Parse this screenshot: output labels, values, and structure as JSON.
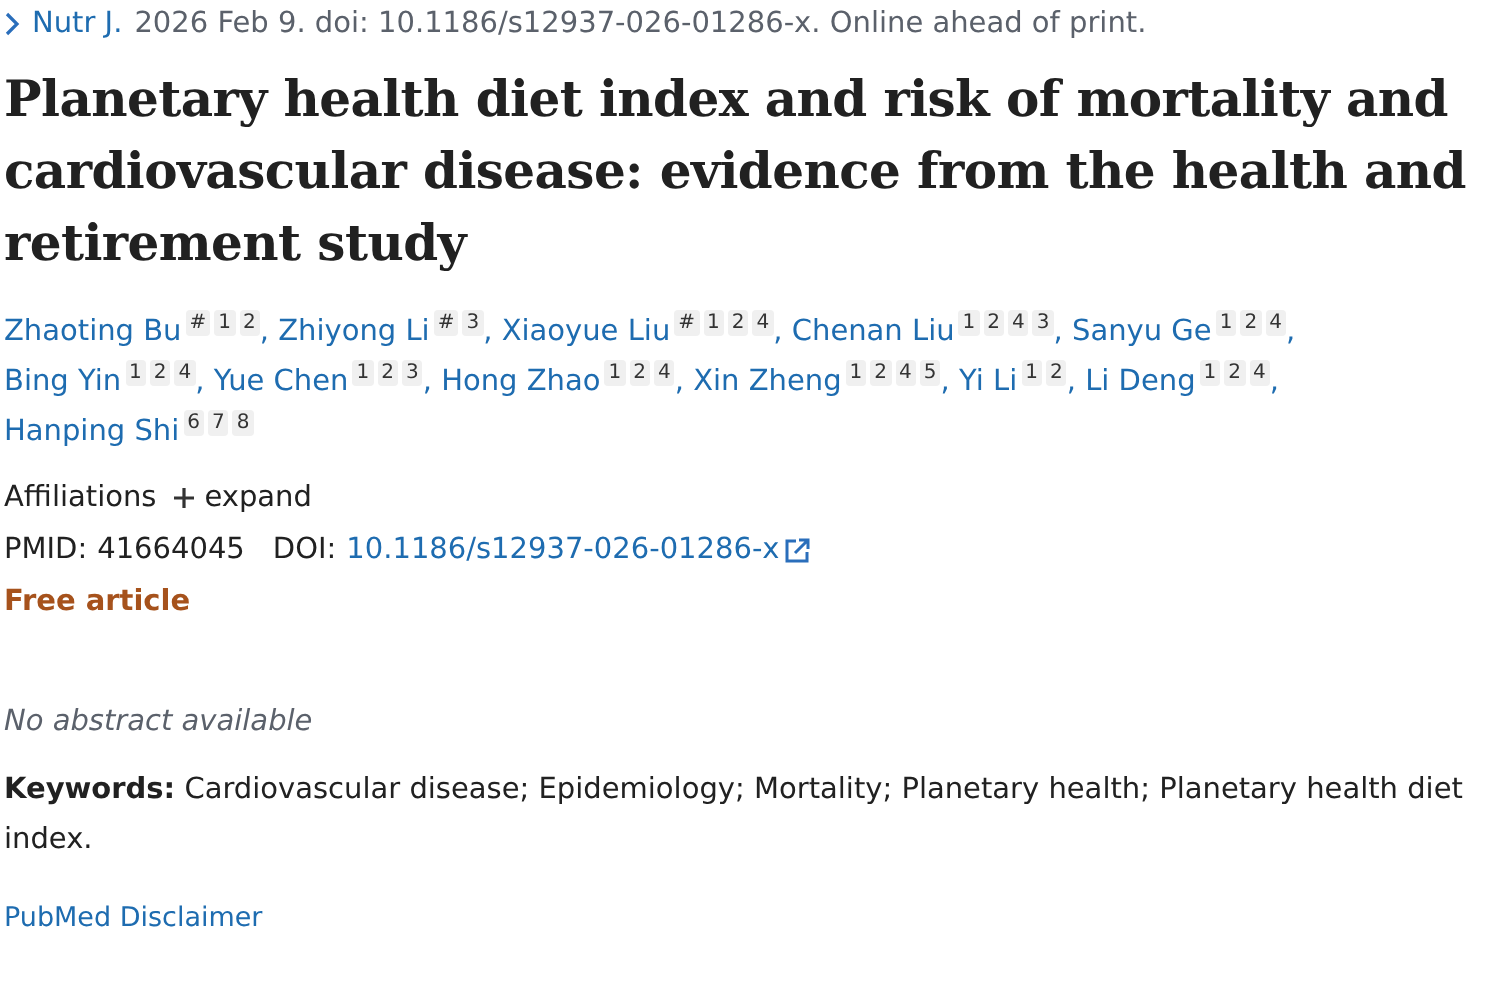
{
  "citation": {
    "journal": "Nutr J.",
    "details": "2026 Feb 9. doi: 10.1186/s12937-026-01286-x. Online ahead of print."
  },
  "title": "Planetary health diet index and risk of mortality and cardiovascular disease: evidence from the health and retirement study",
  "authors": [
    {
      "name": "Zhaoting Bu",
      "marks": [
        "#",
        "1",
        "2"
      ],
      "trailing": ","
    },
    {
      "name": "Zhiyong Li",
      "marks": [
        "#",
        "3"
      ],
      "trailing": ","
    },
    {
      "name": "Xiaoyue Liu",
      "marks": [
        "#",
        "1",
        "2",
        "4"
      ],
      "trailing": ","
    },
    {
      "name": "Chenan Liu",
      "marks": [
        "1",
        "2",
        "4",
        "3"
      ],
      "trailing": ","
    },
    {
      "name": "Sanyu Ge",
      "marks": [
        "1",
        "2",
        "4"
      ],
      "trailing": ","
    },
    {
      "name": "Bing Yin",
      "marks": [
        "1",
        "2",
        "4"
      ],
      "trailing": ","
    },
    {
      "name": "Yue Chen",
      "marks": [
        "1",
        "2",
        "3"
      ],
      "trailing": ","
    },
    {
      "name": "Hong Zhao",
      "marks": [
        "1",
        "2",
        "4"
      ],
      "trailing": ","
    },
    {
      "name": "Xin Zheng",
      "marks": [
        "1",
        "2",
        "4",
        "5"
      ],
      "trailing": ","
    },
    {
      "name": "Yi Li",
      "marks": [
        "1",
        "2"
      ],
      "trailing": ","
    },
    {
      "name": "Li Deng",
      "marks": [
        "1",
        "2",
        "4"
      ],
      "trailing": ","
    },
    {
      "name": "Hanping Shi",
      "marks": [
        "6",
        "7",
        "8"
      ]
    }
  ],
  "affiliations": {
    "label": "Affiliations",
    "toggle": "expand",
    "expanded": false
  },
  "identifiers": {
    "pmid_label": "PMID:",
    "pmid": "41664045",
    "doi_label": "DOI:",
    "doi": "10.1186/s12937-026-01286-x"
  },
  "free_article": "Free article",
  "abstract_note": "No abstract available",
  "keywords": "**Keywords:** Cardiovascular disease; Epidemiology; Mortality; Planetary health; Planetary health diet index.",
  "disclaimer_link": "PubMed Disclaimer"
}
